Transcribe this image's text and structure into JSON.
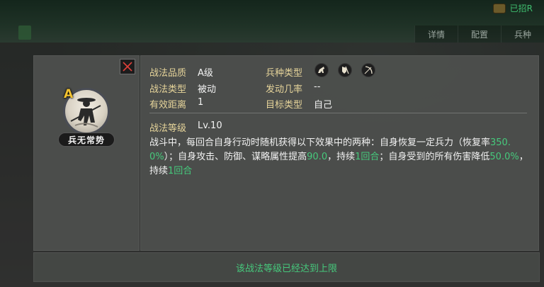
{
  "topbar": {
    "resource_text": "已招R",
    "tabs": [
      "详情",
      "配置",
      "兵种"
    ]
  },
  "skill": {
    "grade": "A",
    "name": "兵无常势"
  },
  "attributes": {
    "quality_label": "战法品质",
    "quality_value": "A级",
    "troop_type_label": "兵种类型",
    "troop_icons": [
      "cavalry-icon",
      "shield-infantry-icon",
      "bow-icon"
    ],
    "skill_type_label": "战法类型",
    "skill_type_value": "被动",
    "trigger_rate_label": "发动几率",
    "trigger_rate_value": "--",
    "range_label": "有效距离",
    "range_value": "1",
    "target_label": "目标类型",
    "target_value": "自己",
    "level_label": "战法等级",
    "level_value": "Lv.10"
  },
  "description": {
    "p1": "战斗中，每回合自身行动时随机获得以下效果中的两种：自身恢复一定兵力（恢复率",
    "v1": "350.0%",
    "p2": "）；自身攻击、防御、谋略属性提高",
    "v2": "90.0",
    "p3": "，持续",
    "v3": "1回合",
    "p4": "；自身受到的所有伤害降低",
    "v4": "50.0%",
    "p5": "，持续",
    "v5": "1回合"
  },
  "footer": {
    "message": "该战法等级已经达到上限"
  },
  "colors": {
    "label_gold": "#e6d49a",
    "highlight_green": "#46c97c",
    "grade_yellow": "#f2c230"
  }
}
